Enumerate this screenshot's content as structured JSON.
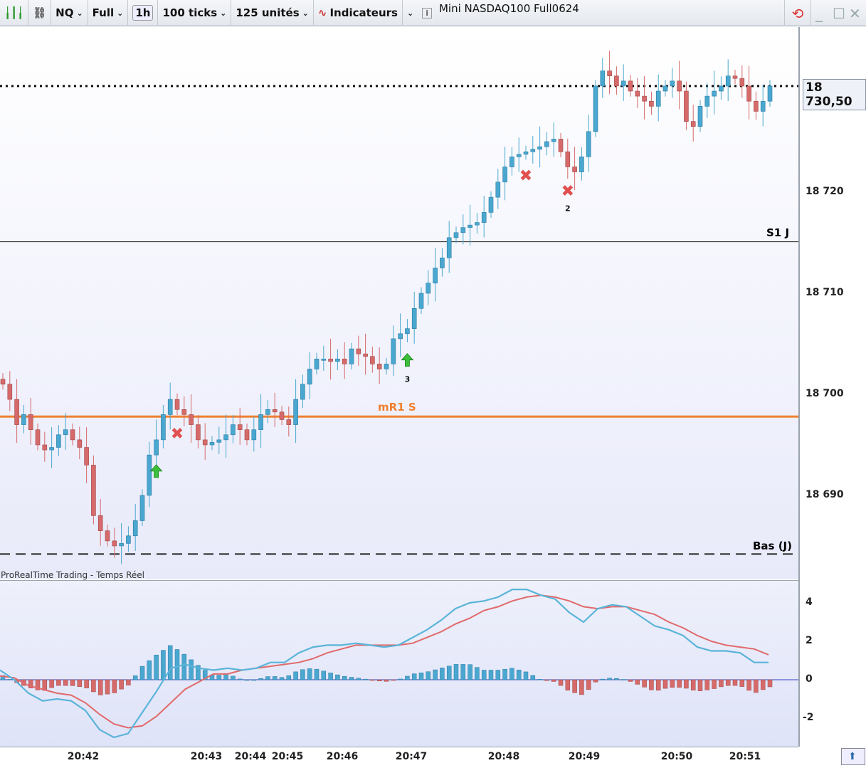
{
  "toolbar": {
    "symbol": "NQ",
    "mode": "Full",
    "timeframe": "1h",
    "ticks": "100 ticks",
    "units": "125 unités",
    "indicators": "Indicateurs",
    "title": "Mini NASDAQ100 Full0624"
  },
  "colors": {
    "up": "#4aa8d0",
    "down": "#d66a6a",
    "macd": "#5ab4d8",
    "signal": "#e06a6a",
    "level_orange": "#f08030"
  },
  "price_axis": {
    "ticks": [
      "18 720",
      "18 710",
      "18 700",
      "18 690"
    ],
    "tick_values": [
      18720,
      18710,
      18700,
      18690
    ],
    "current_price": "18 730,50",
    "current_value": 18730.5
  },
  "levels": [
    {
      "label": "S1 J",
      "value": 18715.1,
      "style": "solid"
    },
    {
      "label": "mR1 S",
      "value": 18697.8,
      "style": "orange"
    },
    {
      "label": "Bas (J)",
      "value": 18684.2,
      "style": "dashed"
    }
  ],
  "source_label": "ProRealTime Trading - Temps Réel",
  "time_axis": [
    "20:42",
    "20:43",
    "20:44",
    "20:45",
    "20:46",
    "20:47",
    "20:48",
    "20:49",
    "20:50",
    "20:51"
  ],
  "osc_axis": [
    "4",
    "2",
    "0",
    "-2"
  ],
  "chart_data": {
    "type": "candlestick",
    "closes": [
      18701,
      18699.5,
      18697,
      18698,
      18696.5,
      18695,
      18694.5,
      18694.75,
      18696,
      18696.5,
      18695.5,
      18694.75,
      18693,
      18688,
      18686.5,
      18685.5,
      18685,
      18685.25,
      18686,
      18687.5,
      18690,
      18694,
      18695.5,
      18698,
      18699.5,
      18698.5,
      18698,
      18697,
      18695.5,
      18695,
      18695.25,
      18695.5,
      18696,
      18697,
      18696.5,
      18695.5,
      18696.5,
      18698,
      18698.5,
      18698.25,
      18697.5,
      18697,
      18699.5,
      18701,
      18702.5,
      18703.5,
      18703.5,
      18703.25,
      18703.5,
      18703,
      18704.5,
      18704,
      18703.75,
      18703,
      18702.5,
      18703,
      18705.5,
      18706,
      18706.5,
      18708.5,
      18710,
      18711,
      18712.5,
      18713.5,
      18715.5,
      18716,
      18716.5,
      18716.75,
      18717,
      18718,
      18719.5,
      18721,
      18722.5,
      18723.5,
      18723.75,
      18724,
      18724.25,
      18724.5,
      18725,
      18725.25,
      18724,
      18722.5,
      18722,
      18723.5,
      18726,
      18730.5,
      18732,
      18731.5,
      18730.5,
      18731,
      18730,
      18729.5,
      18729,
      18728.5,
      18730,
      18730.5,
      18731,
      18730,
      18727,
      18726.5,
      18728.5,
      18729.5,
      18730,
      18730.5,
      18731.5,
      18731.25,
      18730.5,
      18729,
      18728,
      18729,
      18730.5
    ],
    "markers": [
      {
        "type": "sell",
        "candle": 25
      },
      {
        "type": "buy",
        "candle": 22
      },
      {
        "type": "buy",
        "candle": 58,
        "label": "3"
      },
      {
        "type": "sell",
        "candle": 75
      },
      {
        "type": "sell",
        "candle": 81,
        "label": "2"
      }
    ],
    "oscillator": {
      "macd": [
        0.5,
        0,
        -0.7,
        -1.1,
        -1.0,
        -1.1,
        -1.6,
        -2.6,
        -3.0,
        -2.8,
        -1.7,
        -0.6,
        0.6,
        0.8,
        0.6,
        0.5,
        0.6,
        0.5,
        0.6,
        0.9,
        0.9,
        1.4,
        1.7,
        1.8,
        1.8,
        1.9,
        1.8,
        1.7,
        1.8,
        2.2,
        2.6,
        3.1,
        3.7,
        4.0,
        4.1,
        4.3,
        4.7,
        4.7,
        4.4,
        4.2,
        3.5,
        3.0,
        3.7,
        3.9,
        3.8,
        3.3,
        2.8,
        2.6,
        2.3,
        1.7,
        1.5,
        1.5,
        1.4,
        0.9,
        0.9
      ],
      "signal": [
        0.2,
        0.1,
        -0.3,
        -0.5,
        -0.7,
        -0.8,
        -1.2,
        -1.8,
        -2.3,
        -2.5,
        -2.4,
        -1.9,
        -1.2,
        -0.5,
        -0.1,
        0.3,
        0.3,
        0.5,
        0.6,
        0.7,
        0.8,
        0.9,
        1.1,
        1.4,
        1.6,
        1.8,
        1.8,
        1.8,
        1.8,
        1.9,
        2.2,
        2.5,
        2.9,
        3.2,
        3.6,
        3.8,
        4.1,
        4.3,
        4.4,
        4.3,
        4.1,
        3.8,
        3.7,
        3.8,
        3.8,
        3.6,
        3.4,
        3.0,
        2.7,
        2.3,
        2.0,
        1.8,
        1.7,
        1.6,
        1.3
      ],
      "histogram": [
        0.3,
        -0.1,
        -0.4,
        -0.6,
        -0.3,
        -0.3,
        -0.4,
        -0.8,
        -0.7,
        -0.3,
        0.7,
        1.3,
        1.8,
        1.3,
        0.7,
        0.2,
        0.3,
        0,
        0,
        0.2,
        0.1,
        0.5,
        0.6,
        0.4,
        0.2,
        0.1,
        0,
        -0.1,
        0,
        0.3,
        0.4,
        0.6,
        0.8,
        0.8,
        0.5,
        0.5,
        0.6,
        0.4,
        0,
        -0.1,
        -0.6,
        -0.8,
        0,
        0.1,
        0,
        -0.3,
        -0.6,
        -0.4,
        -0.4,
        -0.6,
        -0.5,
        -0.3,
        -0.3,
        -0.7,
        -0.4
      ]
    }
  }
}
